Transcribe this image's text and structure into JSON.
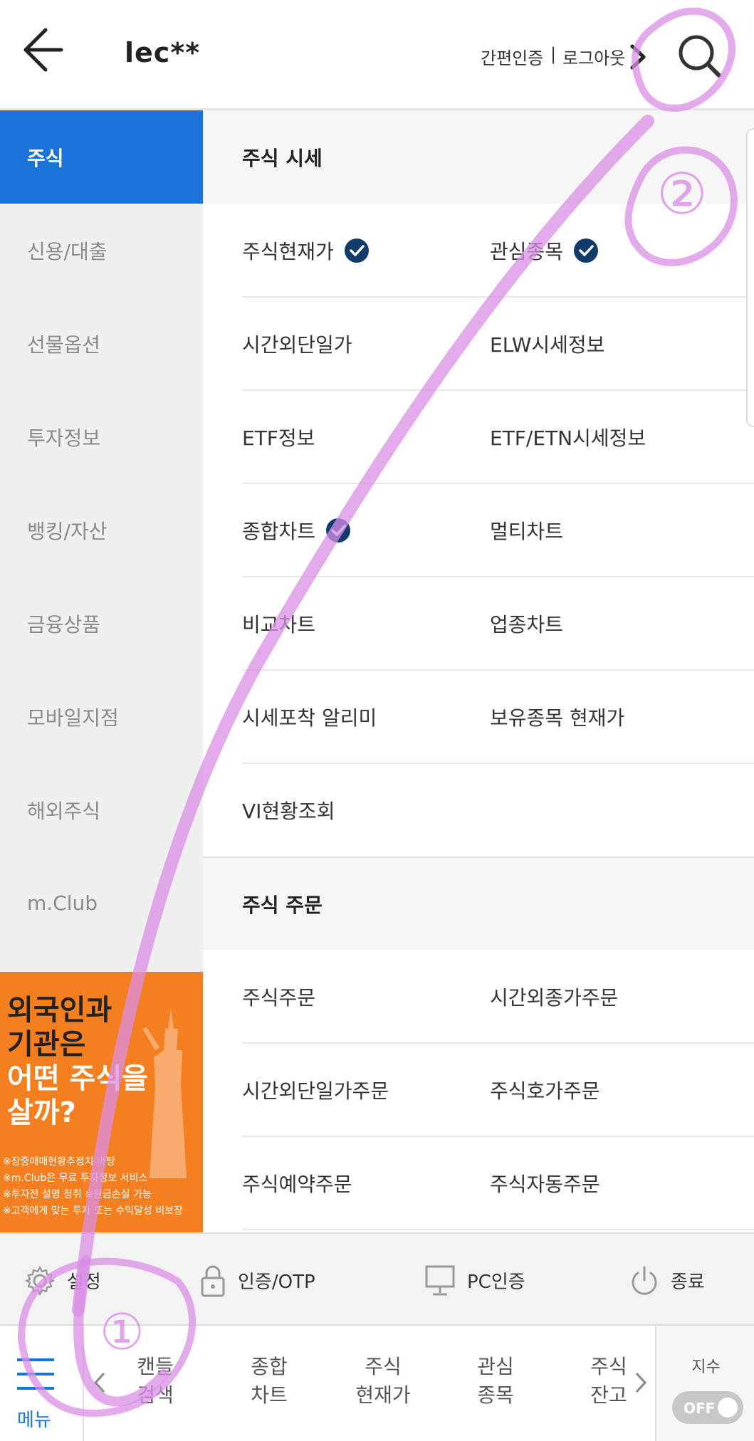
{
  "header": {
    "user_id": "lec**",
    "auth_label": "간편인증",
    "separator": "|",
    "logout_label": "로그아웃"
  },
  "sidebar": {
    "items": [
      {
        "label": "주식",
        "active": true
      },
      {
        "label": "신용/대출"
      },
      {
        "label": "선물옵션"
      },
      {
        "label": "투자정보"
      },
      {
        "label": "뱅킹/자산"
      },
      {
        "label": "금융상품"
      },
      {
        "label": "모바일지점"
      },
      {
        "label": "해외주식"
      },
      {
        "label": "m.Club"
      }
    ]
  },
  "ad": {
    "lines": [
      "외국인과",
      "기관은",
      "어떤 주식을",
      "살까?"
    ],
    "notes": [
      "※장중매매현황추정치 바탕",
      "※m.Club은 무료 투자정보 서비스",
      "※투자전 설명 청취  ※원금손실 가능",
      "※고객에게 맞는 투자 또는 수익달성 비보장"
    ]
  },
  "content": {
    "sections": [
      {
        "title": "주식 시세",
        "items": [
          {
            "label": "주식현재가",
            "checked": true
          },
          {
            "label": "관심종목",
            "checked": true
          },
          {
            "label": "시간외단일가"
          },
          {
            "label": "ELW시세정보"
          },
          {
            "label": "ETF정보"
          },
          {
            "label": "ETF/ETN시세정보"
          },
          {
            "label": "종합차트",
            "checked": true
          },
          {
            "label": "멀티차트"
          },
          {
            "label": "비교차트"
          },
          {
            "label": "업종차트"
          },
          {
            "label": "시세포착 알리미"
          },
          {
            "label": "보유종목 현재가"
          },
          {
            "label": "VI현황조회"
          }
        ]
      },
      {
        "title": "주식 주문",
        "items": [
          {
            "label": "주식주문"
          },
          {
            "label": "시간외종가주문"
          },
          {
            "label": "시간외단일가주문"
          },
          {
            "label": "주식호가주문"
          },
          {
            "label": "주식예약주문"
          },
          {
            "label": "주식자동주문"
          }
        ]
      }
    ]
  },
  "action_bar": {
    "settings": "설정",
    "auth_otp": "인증/OTP",
    "pc_auth": "PC인증",
    "exit": "종료"
  },
  "tabbar": {
    "menu": "메뉴",
    "tabs": [
      {
        "line1": "캔들",
        "line2": "검색"
      },
      {
        "line1": "종합",
        "line2": "차트"
      },
      {
        "line1": "주식",
        "line2": "현재가"
      },
      {
        "line1": "관심",
        "line2": "종목"
      },
      {
        "line1": "주식",
        "line2": "잔고"
      }
    ],
    "index_label": "지수",
    "toggle": "OFF"
  },
  "annotations": {
    "marks": [
      "①",
      "②"
    ],
    "color": "#d98ee6"
  },
  "colors": {
    "accent": "#1a73d9",
    "check": "#123a6b",
    "ad_bg": "#f47f20"
  }
}
